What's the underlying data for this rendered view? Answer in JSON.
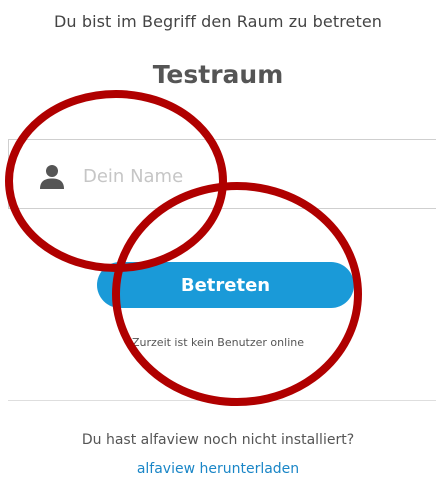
{
  "join": {
    "intro_text": "Du bist im Begriff den Raum zu betreten",
    "room_name": "Testraum",
    "name_placeholder": "Dein Name",
    "name_value": "",
    "join_label": "Betreten",
    "online_status": "Zurzeit ist kein Benutzer online"
  },
  "footer": {
    "not_installed_text": "Du hast alfaview noch nicht installiert?",
    "download_label": "alfaview herunterladen"
  },
  "icons": {
    "user": "user-icon"
  },
  "colors": {
    "accent": "#1a9ad8",
    "link": "#1a86c7",
    "annotation": "#b00000"
  }
}
